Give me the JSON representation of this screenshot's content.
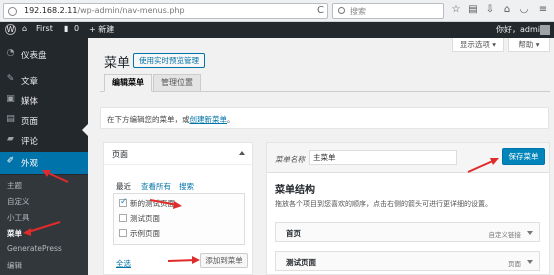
{
  "browser": {
    "url_main": "192.168.2.11",
    "url_path": "/wp-admin/nav-menus.php",
    "search_placeholder": "搜索",
    "refresh_glyph": "C",
    "icons": [
      "star-icon",
      "reading-list-icon",
      "download-icon",
      "home-icon",
      "pocket-icon",
      "menu-icon"
    ]
  },
  "adminbar": {
    "site_name": "First",
    "comments_count": "0",
    "new_label": "+ 新建",
    "greeting": "你好，admin"
  },
  "sidebar": {
    "items": [
      {
        "icon": "dashboard-icon",
        "glyph": "◔",
        "label": "仪表盘"
      },
      {
        "icon": "pin-icon",
        "glyph": "✎",
        "label": "文章"
      },
      {
        "icon": "media-icon",
        "glyph": "▣",
        "label": "媒体"
      },
      {
        "icon": "page-icon",
        "glyph": "▤",
        "label": "页面"
      },
      {
        "icon": "comment-icon",
        "glyph": "▰",
        "label": "评论"
      },
      {
        "icon": "brush-icon",
        "glyph": "✐",
        "label": "外观"
      }
    ],
    "submenu": [
      "主题",
      "自定义",
      "小工具",
      "菜单",
      "GeneratePress",
      "编辑"
    ],
    "active_color": "#0073aa"
  },
  "header": {
    "screen_options": "显示选项",
    "help": "帮助",
    "title": "菜单",
    "live_manage": "使用实时预览管理"
  },
  "tabs": [
    {
      "label": "编辑菜单"
    },
    {
      "label": "管理位置"
    }
  ],
  "manage": {
    "text_before": "在下方编辑您的菜单，或",
    "link_text": "创建新菜单",
    "text_after": "。"
  },
  "add_panel": {
    "title": "页面",
    "tabs": [
      "最近",
      "查看所有",
      "搜索"
    ],
    "items": [
      {
        "label": "新的测试页面",
        "checked": true
      },
      {
        "label": "测试页面",
        "checked": false
      },
      {
        "label": "示例页面",
        "checked": false
      }
    ],
    "select_all": "全选",
    "add_button": "添加到菜单"
  },
  "menu_panel": {
    "name_label": "菜单名称",
    "name_value": "主菜单",
    "save_button": "保存菜单",
    "structure_title": "菜单结构",
    "structure_desc": "拖放各个项目到您喜欢的顺序，点击右侧的箭头可进行更详细的设置。",
    "items": [
      {
        "title": "首页",
        "type": "自定义链接"
      },
      {
        "title": "测试页面",
        "type": "页面"
      }
    ]
  },
  "colors": {
    "accent": "#0073aa",
    "save_button": "#0085ba",
    "annotation": "#e02b2b"
  }
}
